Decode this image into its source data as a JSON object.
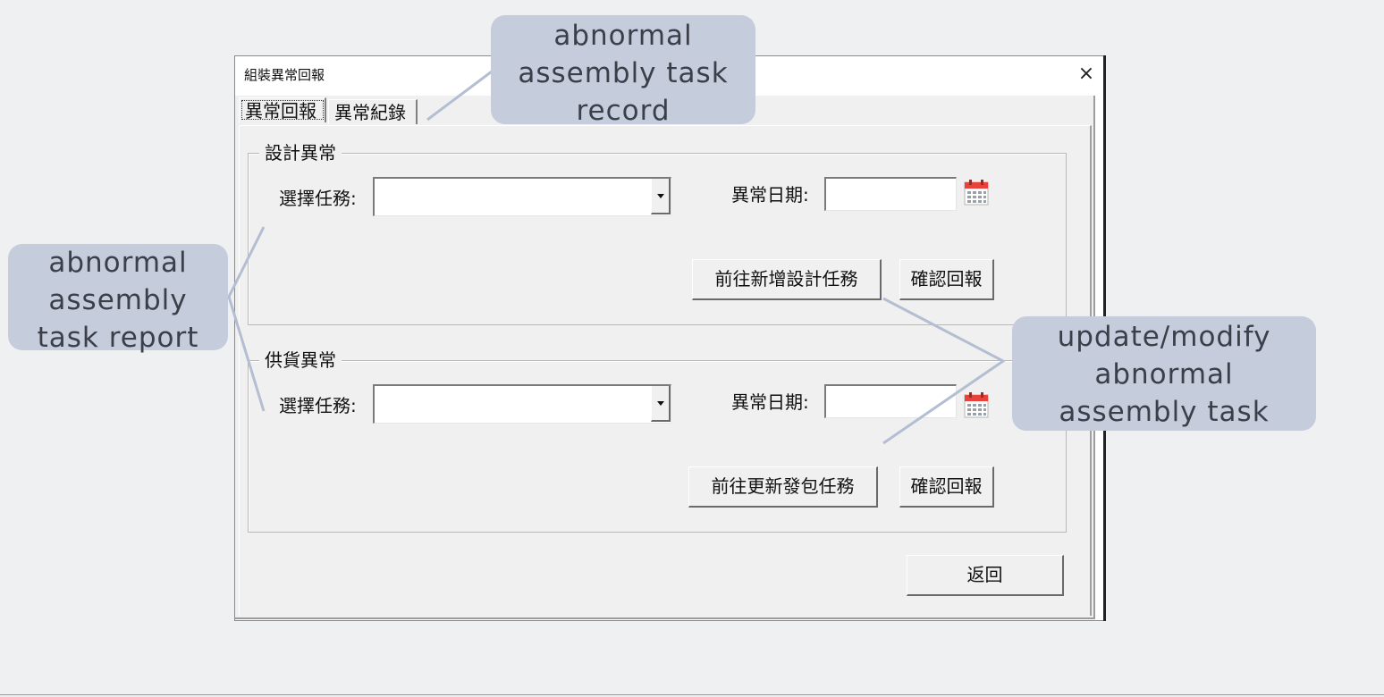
{
  "window": {
    "title": "組裝異常回報",
    "close_glyph": "×"
  },
  "tabs": [
    {
      "label": "異常回報",
      "active": true
    },
    {
      "label": "異常紀錄",
      "active": false
    }
  ],
  "design_group": {
    "legend": "設計異常",
    "task_label": "選擇任務:",
    "task_value": "",
    "date_label": "異常日期:",
    "date_value": "",
    "goto_button": "前往新增設計任務",
    "confirm_button": "確認回報"
  },
  "supply_group": {
    "legend": "供貨異常",
    "task_label": "選擇任務:",
    "task_value": "",
    "date_label": "異常日期:",
    "date_value": "",
    "goto_button": "前往更新發包任務",
    "confirm_button": "確認回報"
  },
  "back_button": "返回",
  "icons": {
    "calendar": "calendar-icon",
    "dropdown": "chevron-down-icon",
    "close": "close-icon"
  },
  "annotations": {
    "record": [
      "abnormal",
      "assembly task",
      "record"
    ],
    "report": [
      "abnormal",
      "assembly",
      "task report"
    ],
    "update": [
      "update/modify",
      "abnormal",
      "assembly task"
    ]
  },
  "colors": {
    "callout_bg": "#c5ccdb",
    "callout_text": "#3a3f4a",
    "leader_line": "#b4bed2",
    "dialog_bg": "#f0f0f0",
    "calendar_red": "#e8423a"
  }
}
